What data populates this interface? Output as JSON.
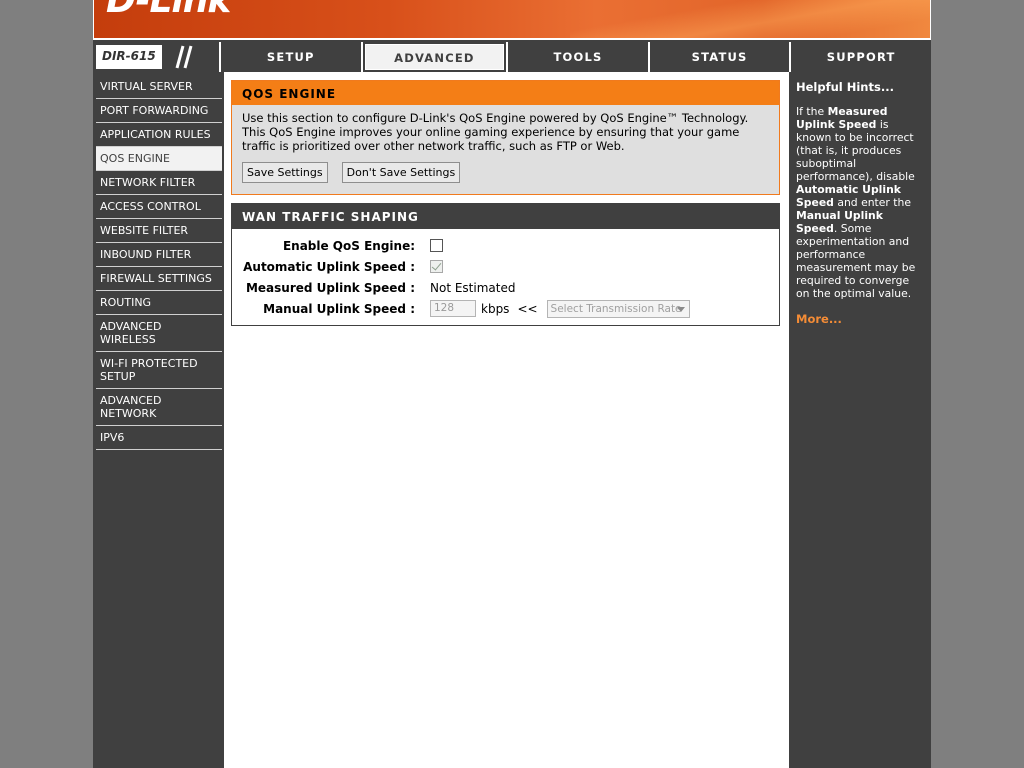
{
  "brand": {
    "logo_text": "D-Link",
    "model": "DIR-615"
  },
  "topnav": {
    "tabs": [
      {
        "label": "SETUP"
      },
      {
        "label": "ADVANCED",
        "active": true
      },
      {
        "label": "TOOLS"
      },
      {
        "label": "STATUS"
      },
      {
        "label": "SUPPORT"
      }
    ]
  },
  "sidebar": {
    "items": [
      {
        "label": "VIRTUAL SERVER"
      },
      {
        "label": "PORT FORWARDING"
      },
      {
        "label": "APPLICATION RULES"
      },
      {
        "label": "QOS ENGINE",
        "active": true
      },
      {
        "label": "NETWORK FILTER"
      },
      {
        "label": "ACCESS CONTROL"
      },
      {
        "label": "WEBSITE FILTER"
      },
      {
        "label": "INBOUND FILTER"
      },
      {
        "label": "FIREWALL SETTINGS"
      },
      {
        "label": "ROUTING"
      },
      {
        "label": "ADVANCED WIRELESS"
      },
      {
        "label": "WI-FI PROTECTED SETUP"
      },
      {
        "label": "ADVANCED NETWORK"
      },
      {
        "label": "IPV6"
      }
    ]
  },
  "qos": {
    "title": "QOS ENGINE",
    "description": "Use this section to configure D-Link's QoS Engine powered by QoS Engine™ Technology. This QoS Engine improves your online gaming experience by ensuring that your game traffic is prioritized over other network traffic, such as FTP or Web.",
    "save_label": "Save Settings",
    "dont_save_label": "Don't Save Settings"
  },
  "wan": {
    "title": "WAN TRAFFIC SHAPING",
    "enable_label": "Enable QoS Engine:",
    "enable_checked": false,
    "auto_label": "Automatic Uplink Speed :",
    "auto_checked": true,
    "auto_disabled": true,
    "measured_label": "Measured Uplink Speed :",
    "measured_value": "Not Estimated",
    "manual_label": "Manual Uplink Speed :",
    "manual_value": "128",
    "manual_unit": "kbps",
    "manual_arrows": "<<",
    "rate_select": "Select Transmission Rate"
  },
  "hints": {
    "title": "Helpful Hints...",
    "p1": "If the ",
    "b1": "Measured Uplink Speed",
    "p2": " is known to be incorrect (that is, it produces suboptimal performance), disable ",
    "b2": "Automatic Uplink Speed",
    "p3": " and enter the ",
    "b3": "Manual Uplink Speed",
    "p4": ". Some experimentation and performance measurement may be required to converge on the optimal value.",
    "more": "More..."
  },
  "colors": {
    "nav_dark": "#404040",
    "accent_orange": "#f47e16",
    "more_link": "#f48c36"
  }
}
